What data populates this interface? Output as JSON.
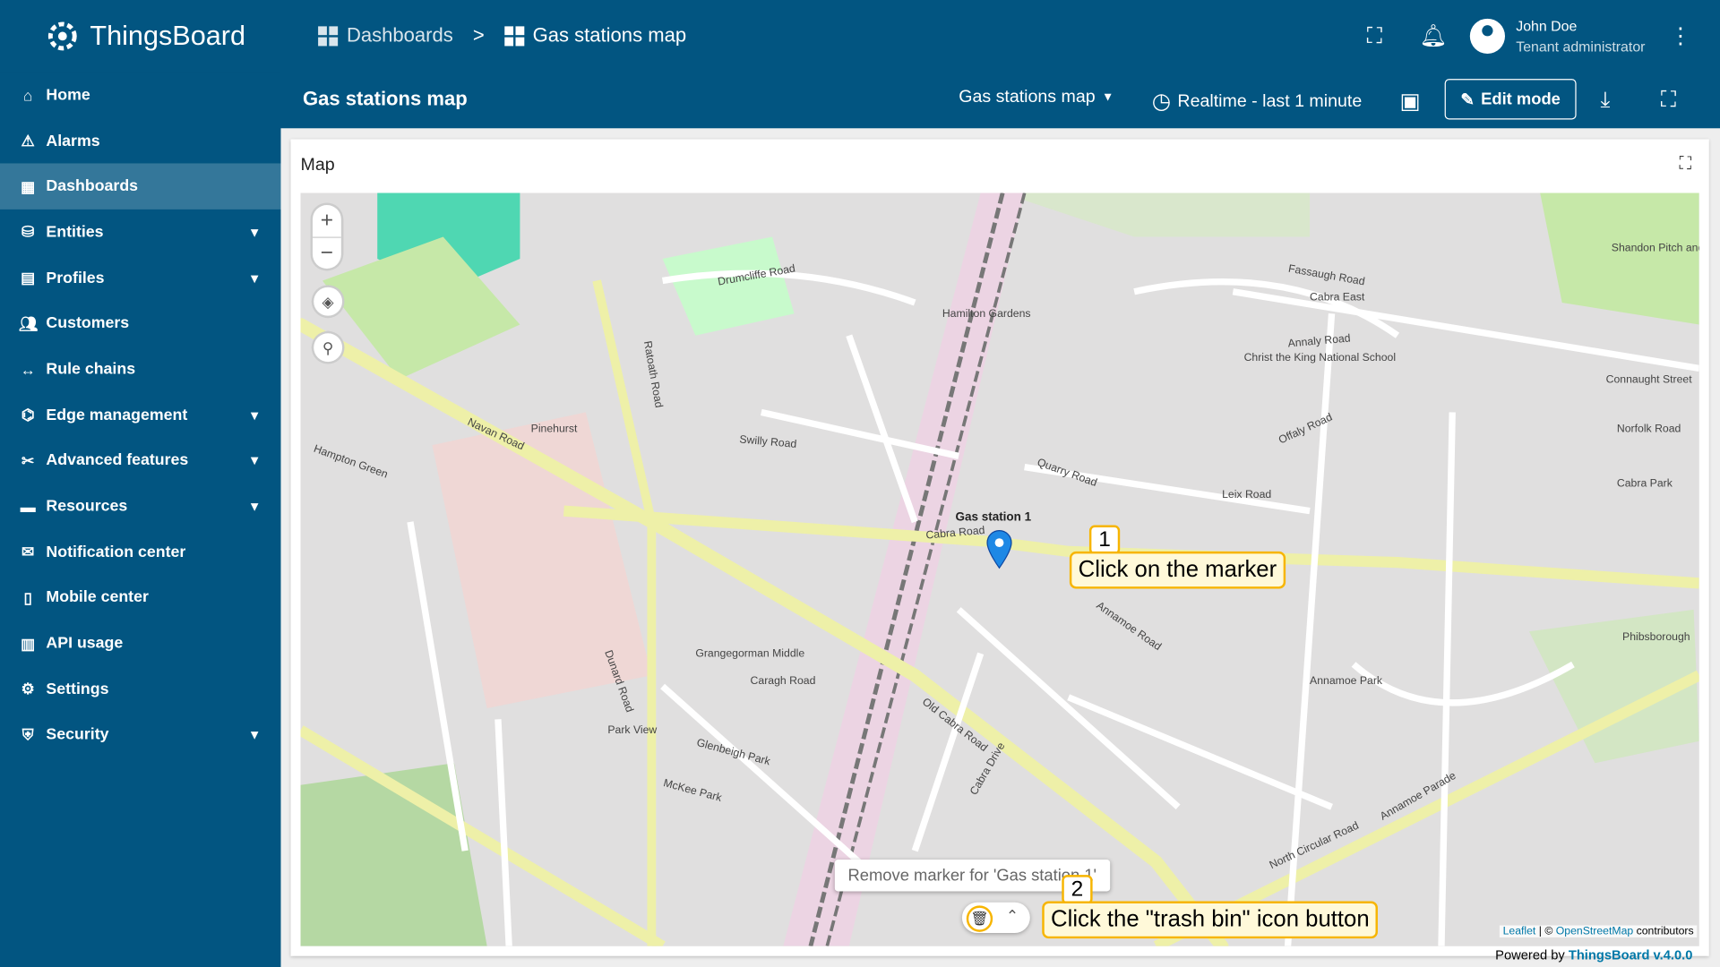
{
  "app": {
    "name": "ThingsBoard"
  },
  "breadcrumb": [
    {
      "label": "Dashboards",
      "icon": "dashboard-icon"
    },
    {
      "separator": ">"
    },
    {
      "label": "Gas stations map",
      "icon": "dashboard-icon"
    }
  ],
  "user": {
    "name": "John Doe",
    "role": "Tenant administrator"
  },
  "toolbar": {
    "title": "Gas stations map",
    "state_select": "Gas stations map",
    "timewindow": "Realtime - last 1 minute",
    "edit_label": "Edit mode"
  },
  "sidebar": {
    "items": [
      {
        "label": "Home",
        "icon": "home-icon"
      },
      {
        "label": "Alarms",
        "icon": "warning-icon"
      },
      {
        "label": "Dashboards",
        "icon": "dashboard-icon",
        "active": true
      },
      {
        "label": "Entities",
        "icon": "entities-icon",
        "expandable": true
      },
      {
        "label": "Profiles",
        "icon": "profiles-icon",
        "expandable": true
      },
      {
        "label": "Customers",
        "icon": "customers-icon"
      },
      {
        "label": "Rule chains",
        "icon": "rule-chain-icon"
      },
      {
        "label": "Edge management",
        "icon": "edge-icon",
        "expandable": true
      },
      {
        "label": "Advanced features",
        "icon": "tools-icon",
        "expandable": true
      },
      {
        "label": "Resources",
        "icon": "folder-icon",
        "expandable": true
      },
      {
        "label": "Notification center",
        "icon": "notification-icon"
      },
      {
        "label": "Mobile center",
        "icon": "mobile-icon"
      },
      {
        "label": "API usage",
        "icon": "chart-icon"
      },
      {
        "label": "Settings",
        "icon": "gear-icon"
      },
      {
        "label": "Security",
        "icon": "shield-icon",
        "expandable": true
      }
    ]
  },
  "widget": {
    "title": "Map",
    "marker_label": "Gas station 1",
    "tooltip": "Remove marker for 'Gas station 1'",
    "callouts": [
      {
        "num": "1",
        "text": "Click on the marker"
      },
      {
        "num": "2",
        "text": "Click the \"trash bin\" icon button"
      }
    ],
    "attribution": {
      "leaflet": "Leaflet",
      "sep": " | © ",
      "osm": "OpenStreetMap",
      "suffix": " contributors"
    },
    "powered": {
      "prefix": "Powered by ",
      "link": "ThingsBoard v.4.0.0"
    },
    "street_labels": [
      "Cabra Road",
      "Navan Road",
      "Old Cabra Road",
      "Cabra Drive",
      "Drumcliffe Road",
      "Quarry Road",
      "Cabra East",
      "Annamoe Road",
      "North Circular Road",
      "Grangegorman Middle",
      "Dunard Road",
      "Glenbeigh Park",
      "Swilly Road",
      "Ratoath Road",
      "Hamilton Gardens",
      "Christ the King National School",
      "Fassaugh Road",
      "Annaly Road",
      "Offaly Road",
      "Leix Road",
      "Annamoe Parade",
      "Hampton Green",
      "Pinehurst",
      "Caragh Road",
      "Park View",
      "McKee Park",
      "Connaught Street",
      "Norfolk Road",
      "Cabra Park",
      "Shandon Pitch and Putt",
      "Annamoe Park",
      "Phibsborough"
    ]
  }
}
